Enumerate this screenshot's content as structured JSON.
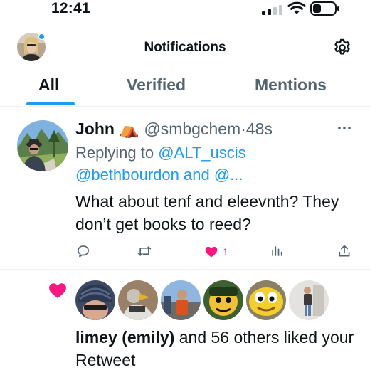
{
  "status_bar": {
    "time": "12:41",
    "signal_icon": "cellular-signal-icon",
    "wifi_icon": "wifi-icon",
    "battery_icon": "battery-icon"
  },
  "header": {
    "title": "Notifications",
    "settings_icon": "gear-icon"
  },
  "tabs": [
    {
      "label": "All",
      "active": true
    },
    {
      "label": "Verified",
      "active": false
    },
    {
      "label": "Mentions",
      "active": false
    }
  ],
  "tweet": {
    "name": "John",
    "name_emoji": "⛺",
    "handle": "@smbgchem",
    "separator": "·",
    "time": "48s",
    "reply_prefix": "Replying to",
    "reply_to_1": "@ALT_uscis",
    "reply_to_2": "@bethbourdon and @...",
    "text": "What about tenf and eleevnth? They don’t get books to reed?",
    "like_count": "1",
    "liked": true
  },
  "like_notification": {
    "liker_name": "limey (emily)",
    "rest_text": "and 56 others liked your Retweet"
  },
  "colors": {
    "accent": "#1d9bf0",
    "like": "#f91880",
    "secondary_text": "#536471",
    "primary_text": "#0f1419"
  }
}
